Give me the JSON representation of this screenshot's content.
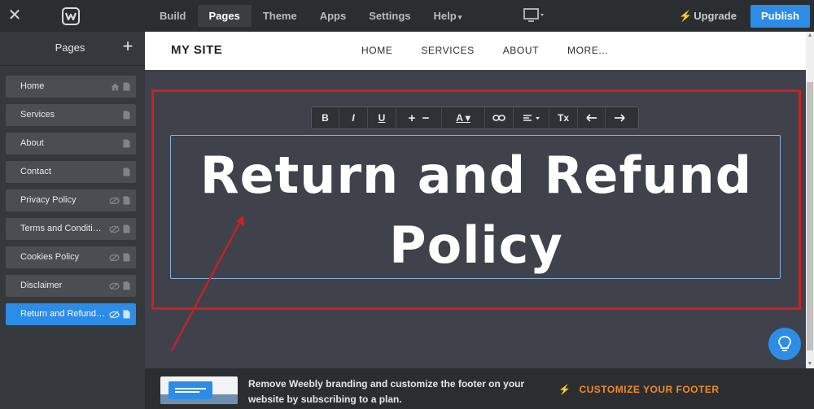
{
  "topbar": {
    "nav": [
      {
        "label": "Build",
        "active": false,
        "caret": ""
      },
      {
        "label": "Pages",
        "active": true,
        "caret": ""
      },
      {
        "label": "Theme",
        "active": false,
        "caret": ""
      },
      {
        "label": "Apps",
        "active": false,
        "caret": ""
      },
      {
        "label": "Settings",
        "active": false,
        "caret": ""
      },
      {
        "label": "Help",
        "active": false,
        "caret": "▾"
      }
    ],
    "upgrade_label": "Upgrade",
    "publish_label": "Publish"
  },
  "sidebar": {
    "title": "Pages",
    "add_symbol": "+",
    "pages": [
      {
        "label": "Home",
        "icon": "home-icon",
        "hidden": false,
        "active": false
      },
      {
        "label": "Services",
        "icon": "page-icon",
        "hidden": false,
        "active": false
      },
      {
        "label": "About",
        "icon": "page-icon",
        "hidden": false,
        "active": false
      },
      {
        "label": "Contact",
        "icon": "page-icon",
        "hidden": false,
        "active": false
      },
      {
        "label": "Privacy Policy",
        "icon": "page-icon",
        "hidden": true,
        "active": false
      },
      {
        "label": "Terms and Conditions",
        "icon": "page-icon",
        "hidden": true,
        "active": false
      },
      {
        "label": "Cookies Policy",
        "icon": "page-icon",
        "hidden": true,
        "active": false
      },
      {
        "label": "Disclaimer",
        "icon": "page-icon",
        "hidden": true,
        "active": false
      },
      {
        "label": "Return and Refund Policy",
        "icon": "page-icon",
        "hidden": true,
        "active": true
      }
    ]
  },
  "site": {
    "title": "MY SITE",
    "nav": [
      "HOME",
      "SERVICES",
      "ABOUT",
      "MORE..."
    ]
  },
  "editor": {
    "toolbar": [
      {
        "name": "bold-button",
        "label": "B"
      },
      {
        "name": "italic-button",
        "label": "I"
      },
      {
        "name": "underline-button",
        "label": "U"
      },
      {
        "name": "font-size-button",
        "label": "+  −"
      },
      {
        "name": "text-color-button",
        "label": "A ▾"
      },
      {
        "name": "link-button",
        "label": "link-icon"
      },
      {
        "name": "align-button",
        "label": "align-icon"
      },
      {
        "name": "clear-format-button",
        "label": "Tx"
      },
      {
        "name": "undo-button",
        "label": "undo-icon"
      },
      {
        "name": "redo-button",
        "label": "redo-icon"
      }
    ],
    "heading_line1": "Return and Refund",
    "heading_line2": "Policy"
  },
  "footer": {
    "promo_text": "Remove Weebly branding and customize the footer on your website by subscribing to a plan.",
    "cta_label": "CUSTOMIZE YOUR FOOTER"
  },
  "colors": {
    "accent": "#2d8ce6",
    "highlight": "#cf1f24",
    "cta": "#f08a26"
  }
}
